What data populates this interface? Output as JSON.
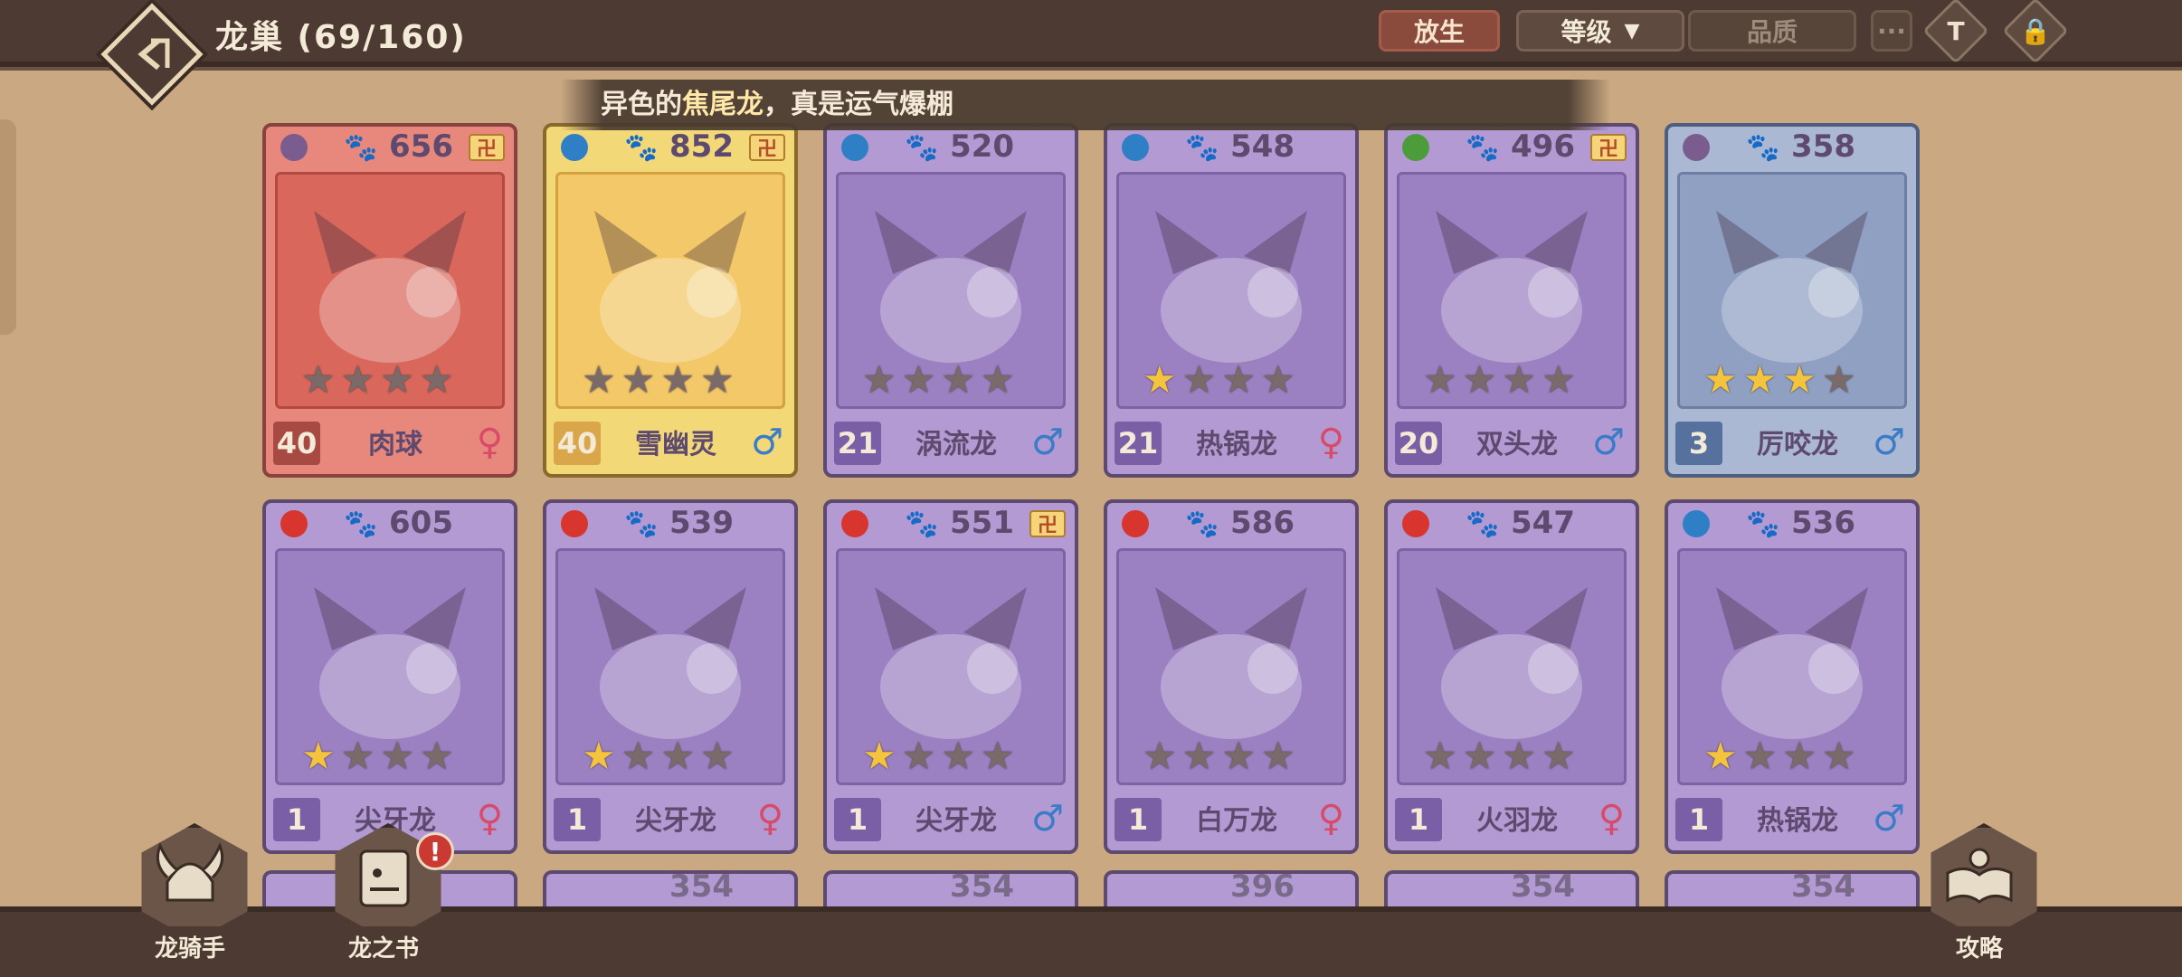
{
  "header": {
    "title": "龙巢 (69/160)",
    "release_label": "放生",
    "sort_label": "等级",
    "quality_label": "品质",
    "more_label": "···",
    "icons": [
      "back-icon",
      "filter-icon",
      "lock-icon"
    ]
  },
  "notification": {
    "prefix": "异色的",
    "highlight": "焦尾龙",
    "suffix": "，真是运气爆棚"
  },
  "row1": [
    {
      "power": "656",
      "level": "40",
      "name": "肉球",
      "sex": "♀",
      "stars": 0,
      "element": "earth"
    },
    {
      "power": "852",
      "level": "40",
      "name": "雪幽灵",
      "sex": "♂",
      "stars": 0,
      "element": "water"
    },
    {
      "power": "520",
      "level": "21",
      "name": "涡流龙",
      "sex": "♂",
      "stars": 0,
      "element": "water"
    },
    {
      "power": "548",
      "level": "21",
      "name": "热锅龙",
      "sex": "♀",
      "stars": 1,
      "element": "water"
    },
    {
      "power": "496",
      "level": "20",
      "name": "双头龙",
      "sex": "♂",
      "stars": 0,
      "element": "nature"
    },
    {
      "power": "358",
      "level": "3",
      "name": "厉咬龙",
      "sex": "♂",
      "stars": 3,
      "element": "earth"
    }
  ],
  "row2": [
    {
      "power": "605",
      "level": "1",
      "name": "尖牙龙",
      "sex": "♀",
      "stars": 1,
      "element": "fire"
    },
    {
      "power": "539",
      "level": "1",
      "name": "尖牙龙",
      "sex": "♀",
      "stars": 1,
      "element": "fire"
    },
    {
      "power": "551",
      "level": "1",
      "name": "尖牙龙",
      "sex": "♂",
      "stars": 1,
      "element": "fire"
    },
    {
      "power": "586",
      "level": "1",
      "name": "白万龙",
      "sex": "♀",
      "stars": 0,
      "element": "fire"
    },
    {
      "power": "547",
      "level": "1",
      "name": "火羽龙",
      "sex": "♀",
      "stars": 0,
      "element": "fire"
    },
    {
      "power": "536",
      "level": "1",
      "name": "热锅龙",
      "sex": "♂",
      "stars": 1,
      "element": "water"
    }
  ],
  "row3_powers": [
    "",
    "354",
    "354",
    "396",
    "354",
    "354"
  ],
  "bottom_nav": {
    "rider_label": "龙骑手",
    "book_label": "龙之书",
    "book_alert": "!",
    "guide_label": "攻略"
  },
  "colors": {
    "fire": "#d8352e",
    "water": "#2f7fc6",
    "earth": "#7a5c8e",
    "nature": "#4c9c3c",
    "male": "#3a7cc8",
    "female": "#d84a6a",
    "star_on": "#f4c43c"
  }
}
